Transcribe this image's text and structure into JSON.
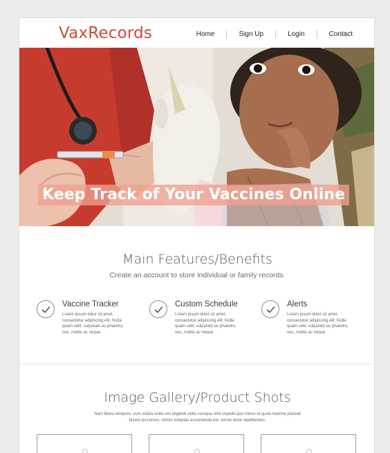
{
  "header": {
    "logo": "VaxRecords",
    "nav": [
      "Home",
      "Sign Up",
      "Login",
      "Contact"
    ]
  },
  "hero": {
    "headline": "Keep Track of Your Vaccines Online"
  },
  "features": {
    "title": "Main Features/Benefits",
    "subtitle": "Create an account to store individual or family records.",
    "items": [
      {
        "title": "Vaccine Tracker",
        "text": "Lorem ipsum dolor sit amet, consectetur adipiscing elit. Nulla quam velit, vulputate eu pharetra nec, mattis ac neque."
      },
      {
        "title": "Custom Schedule",
        "text": "Lorem ipsum dolor sit amet, consectetur adipiscing elit. Nulla quam velit, vulputate eu pharetra nec, mattis ac neque."
      },
      {
        "title": "Alerts",
        "text": "Lorem ipsum dolor sit amet, consectetur adipiscing elit. Nulla quam velit, vulputate eu pharetra nec, mattis ac neque."
      }
    ]
  },
  "gallery": {
    "title": "Image Gallery/Product Shots",
    "subtitle": "Nam libero tempore, cum soluta nobis est eligendi optio cumque nihil impedit quo minus id quod maxime placeat facere possimus, omnis voluptas assumenda est, omnis dolor repellendus."
  },
  "colors": {
    "brand": "#d24a2e",
    "headline_bg": "#efa08f"
  }
}
